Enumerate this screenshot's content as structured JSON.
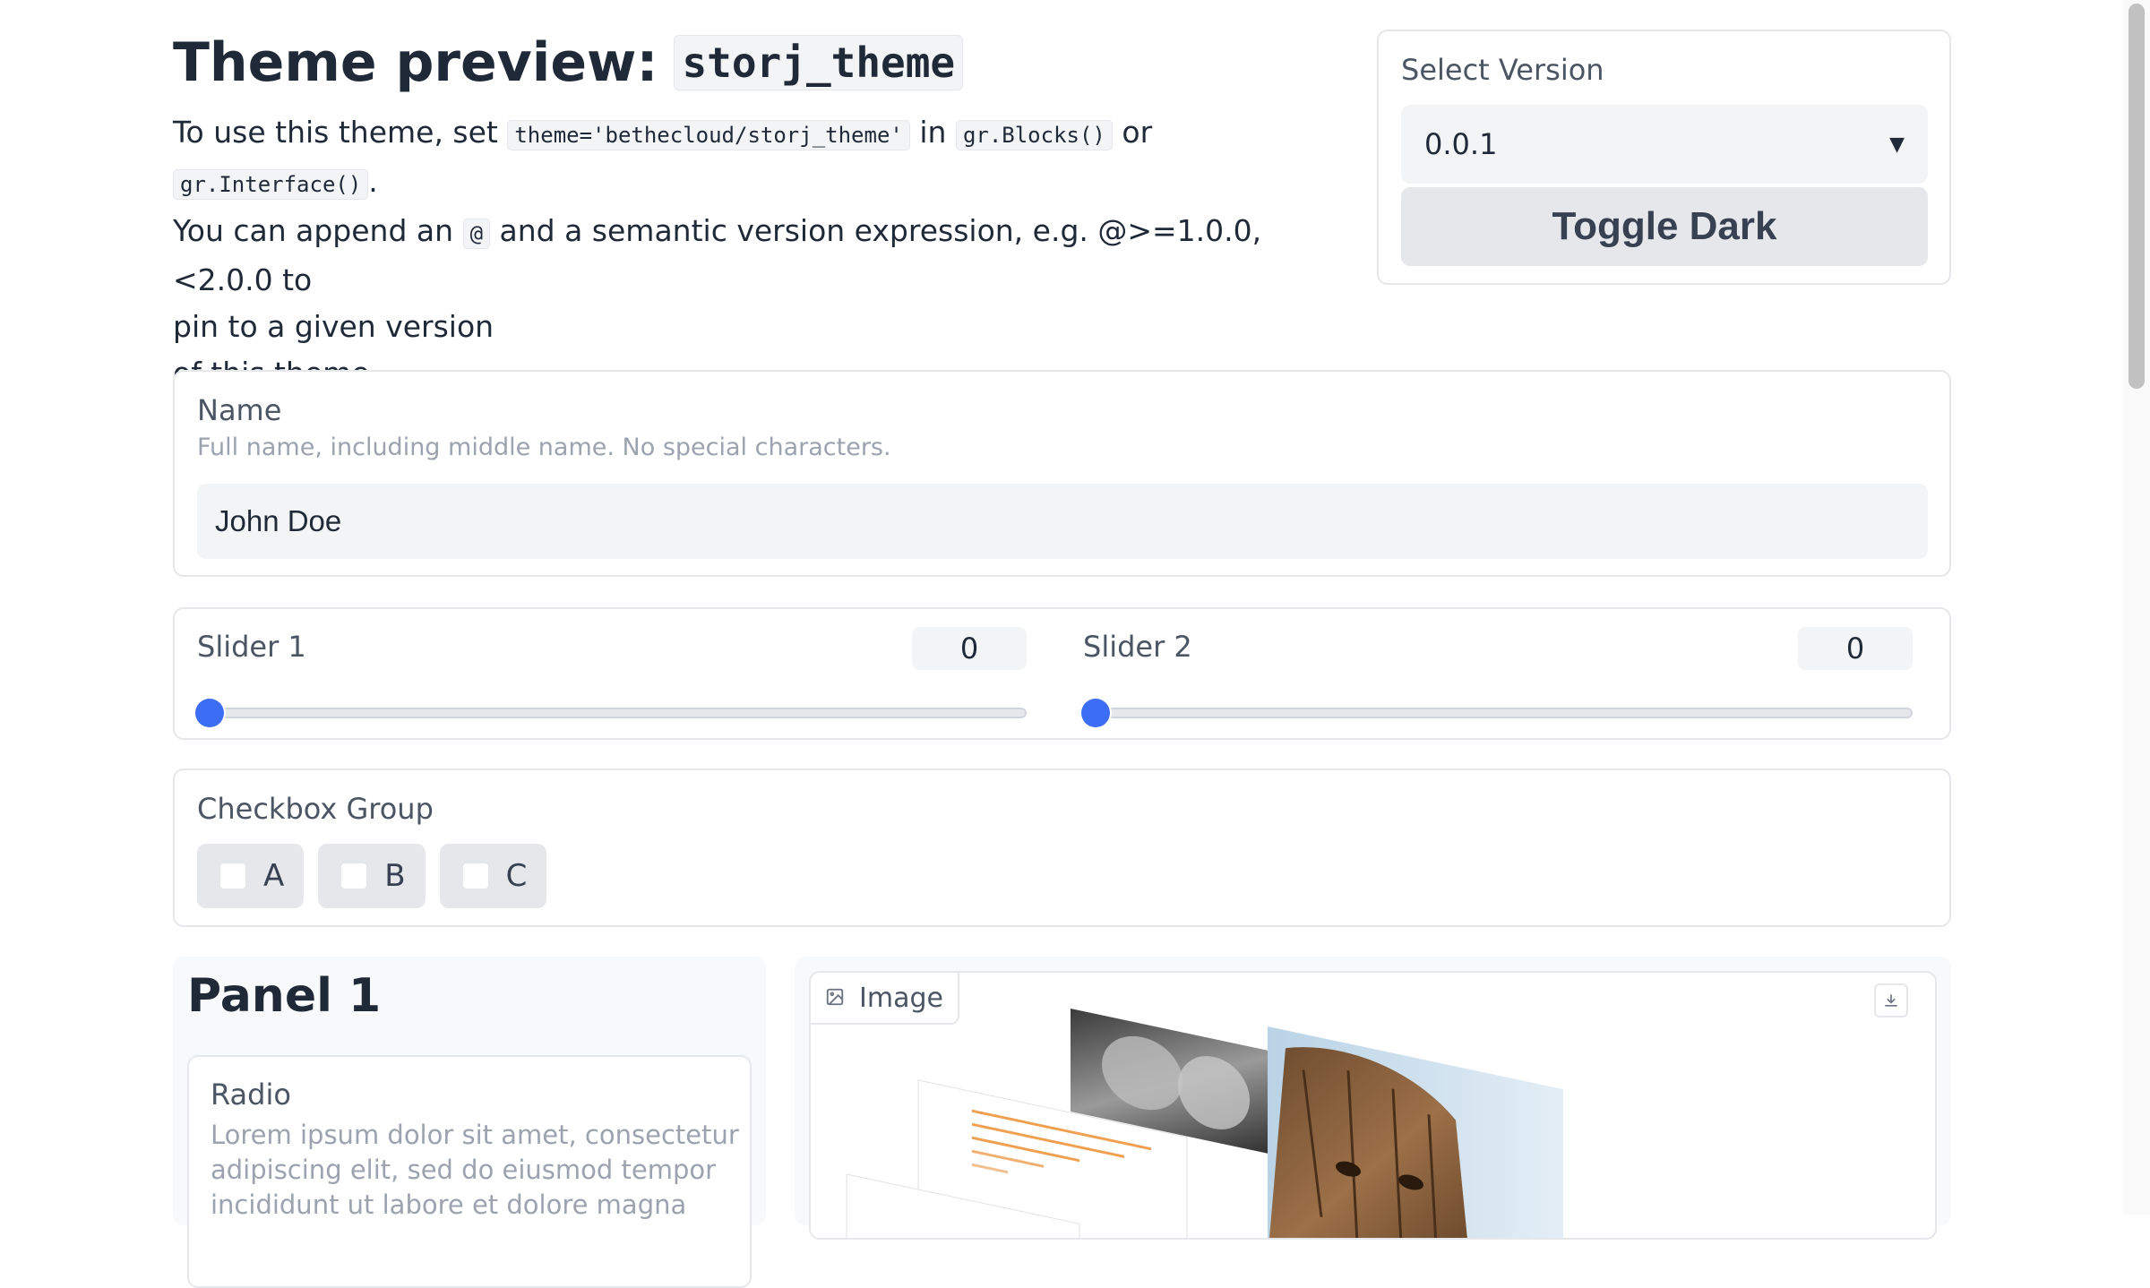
{
  "header": {
    "title_prefix": "Theme preview:",
    "theme_name": "storj_theme",
    "intro": {
      "use_text": "To use this theme, set",
      "code_theme": "theme='bethecloud/storj_theme'",
      "in_text": "in",
      "code_blocks": "gr.Blocks()",
      "or_text": "or",
      "code_interface": "gr.Interface()",
      "period": ".",
      "append_text": "You can append an",
      "code_at": "@",
      "semver_text": "and a semantic version expression, e.g. @>=1.0.0,<2.0.0 to",
      "pin_text": "pin to a given version",
      "of_text": "of this theme."
    }
  },
  "version_panel": {
    "label": "Select Version",
    "selected": "0.0.1",
    "toggle_label": "Toggle Dark"
  },
  "name_field": {
    "label": "Name",
    "info": "Full name, including middle name. No special characters.",
    "value": "John Doe"
  },
  "sliders": [
    {
      "label": "Slider 1",
      "value": "0"
    },
    {
      "label": "Slider 2",
      "value": "0"
    }
  ],
  "checkbox_group": {
    "label": "Checkbox Group",
    "options": [
      "A",
      "B",
      "C"
    ]
  },
  "panel1": {
    "title": "Panel 1",
    "radio_label": "Radio",
    "radio_info": "Lorem ipsum dolor sit amet, consectetur adipiscing elit, sed do eiusmod tempor incididunt ut labore et dolore magna"
  },
  "image_panel": {
    "label": "Image",
    "icon": "image-icon",
    "download_icon": "download-icon"
  },
  "colors": {
    "accent": "#3b6ef5",
    "panel_bg": "#f3f4f6",
    "border": "#e5e7eb"
  }
}
